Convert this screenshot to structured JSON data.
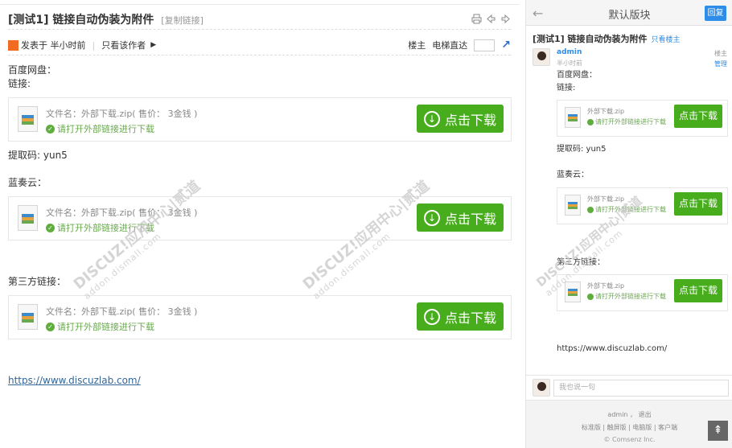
{
  "thread": {
    "title": "[测试1] 链接自动伪装为附件",
    "copy_link": "[复制链接]"
  },
  "meta": {
    "posted": "发表于 半小时前",
    "only_author": "只看该作者",
    "floor": "楼主",
    "elevator": "电梯直达"
  },
  "post": {
    "line1": "百度网盘：",
    "line2": "链接:",
    "extract_code": "提取码: yun5",
    "lanzou": "蓝奏云：",
    "third_party": "第三方链接：",
    "url": "https://www.discuzlab.com/"
  },
  "attachments": [
    {
      "filename": "文件名：外部下载.zip( 售价： 3金钱 )",
      "tip": "请打开外部链接进行下载",
      "button": "点击下载"
    },
    {
      "filename": "文件名：外部下载.zip( 售价： 3金钱 )",
      "tip": "请打开外部链接进行下载",
      "button": "点击下载"
    },
    {
      "filename": "文件名：外部下载.zip( 售价： 3金钱 )",
      "tip": "请打开外部链接进行下载",
      "button": "点击下载"
    }
  ],
  "watermark": {
    "text": "DISCUZ!应用中心|贰道",
    "sub": "addon.dismall.com"
  },
  "mobile": {
    "header_title": "默认版块",
    "reply": "回复",
    "thread_title": "[测试1] 链接自动伪装为附件",
    "only_floor": "只看楼主",
    "author": "admin",
    "time": "半小时前",
    "floor": "楼主",
    "manage": "管理",
    "line1": "百度网盘：",
    "line2": "链接:",
    "extract_code": "提取码: yun5",
    "lanzou": "蓝奏云：",
    "third_party": "第三方链接：",
    "url": "https://www.discuzlab.com/",
    "attachments": [
      {
        "filename": "外部下载.zip",
        "tip": "请打开外部链接进行下载",
        "button": "点击下载"
      },
      {
        "filename": "外部下载.zip",
        "tip": "请打开外部链接进行下载",
        "button": "点击下载"
      },
      {
        "filename": "外部下载.zip",
        "tip": "请打开外部链接进行下载",
        "button": "点击下载"
      }
    ],
    "comment_placeholder": "我也说一句",
    "footer_user": "admin ， 退出",
    "footer_links": "标准版 | 触屏版 | 电脑版 | 客户端",
    "footer_copy": "© Comsenz Inc."
  }
}
